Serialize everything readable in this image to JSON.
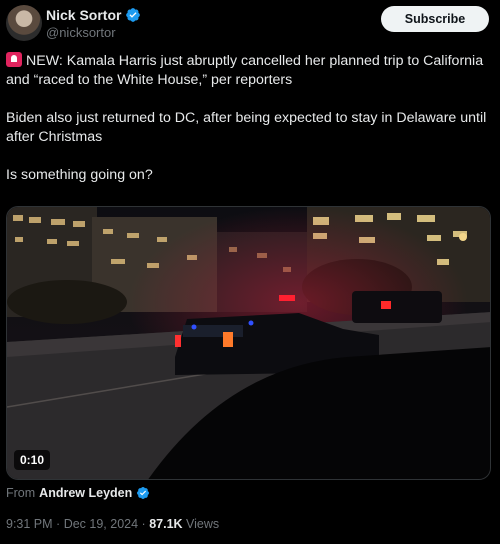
{
  "author": {
    "name": "Nick Sortor",
    "handle": "@nicksortor",
    "verified_color": "#1d9bf0"
  },
  "header": {
    "subscribe_label": "Subscribe",
    "more_icon": "more-icon"
  },
  "tweet": {
    "line1": "NEW: Kamala Harris just abruptly cancelled her planned trip to California and “raced to the White House,” per reporters",
    "line2": "Biden also just returned to DC, after being expected to stay in Delaware until after Christmas",
    "line3": "Is something going on?",
    "emoji_icon": "police-siren-icon"
  },
  "video": {
    "duration": "0:10"
  },
  "source": {
    "prefix": "From",
    "name": "Andrew Leyden"
  },
  "meta": {
    "time": "9:31 PM",
    "separator": "·",
    "date": "Dec 19, 2024",
    "views_count": "87.1K",
    "views_label": "Views"
  },
  "colors": {
    "background": "#000000",
    "text": "#e7e9ea",
    "muted": "#71767b",
    "verified": "#1d9bf0"
  }
}
